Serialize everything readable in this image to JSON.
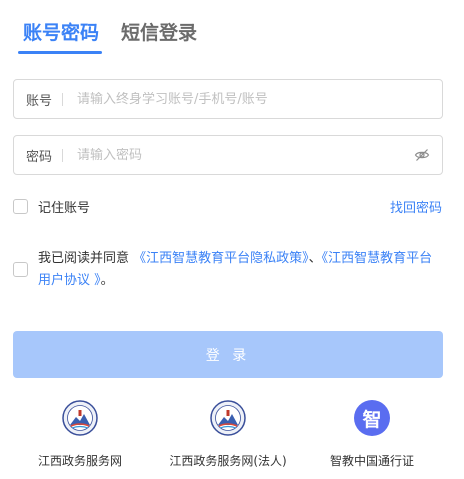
{
  "tabs": {
    "account": "账号密码",
    "sms": "短信登录"
  },
  "account_field": {
    "label": "账号",
    "placeholder": "请输入终身学习账号/手机号/账号"
  },
  "password_field": {
    "label": "密码",
    "placeholder": "请输入密码",
    "eye_icon": "eye-off-icon"
  },
  "remember": {
    "label": "记住账号"
  },
  "forgot": {
    "label": "找回密码"
  },
  "agreement": {
    "prefix": "我已阅读并同意 ",
    "privacy_link": "《江西智慧教育平台隐私政策》",
    "separator": "、",
    "user_link": "《江西智慧教育平台用户协议 》",
    "suffix": "。"
  },
  "login_button": {
    "label": "登 录"
  },
  "alternatives": [
    {
      "label": "江西政务服务网",
      "icon": "jiangxi-gov-emblem-icon"
    },
    {
      "label": "江西政务服务网(法人)",
      "icon": "jiangxi-gov-emblem-icon"
    },
    {
      "label": "智教中国通行证",
      "icon": "zhi-icon",
      "glyph": "智"
    }
  ],
  "colors": {
    "accent": "#3b82f6",
    "button_disabled": "#a7c7fb",
    "zhi_badge": "#5a6df0"
  }
}
